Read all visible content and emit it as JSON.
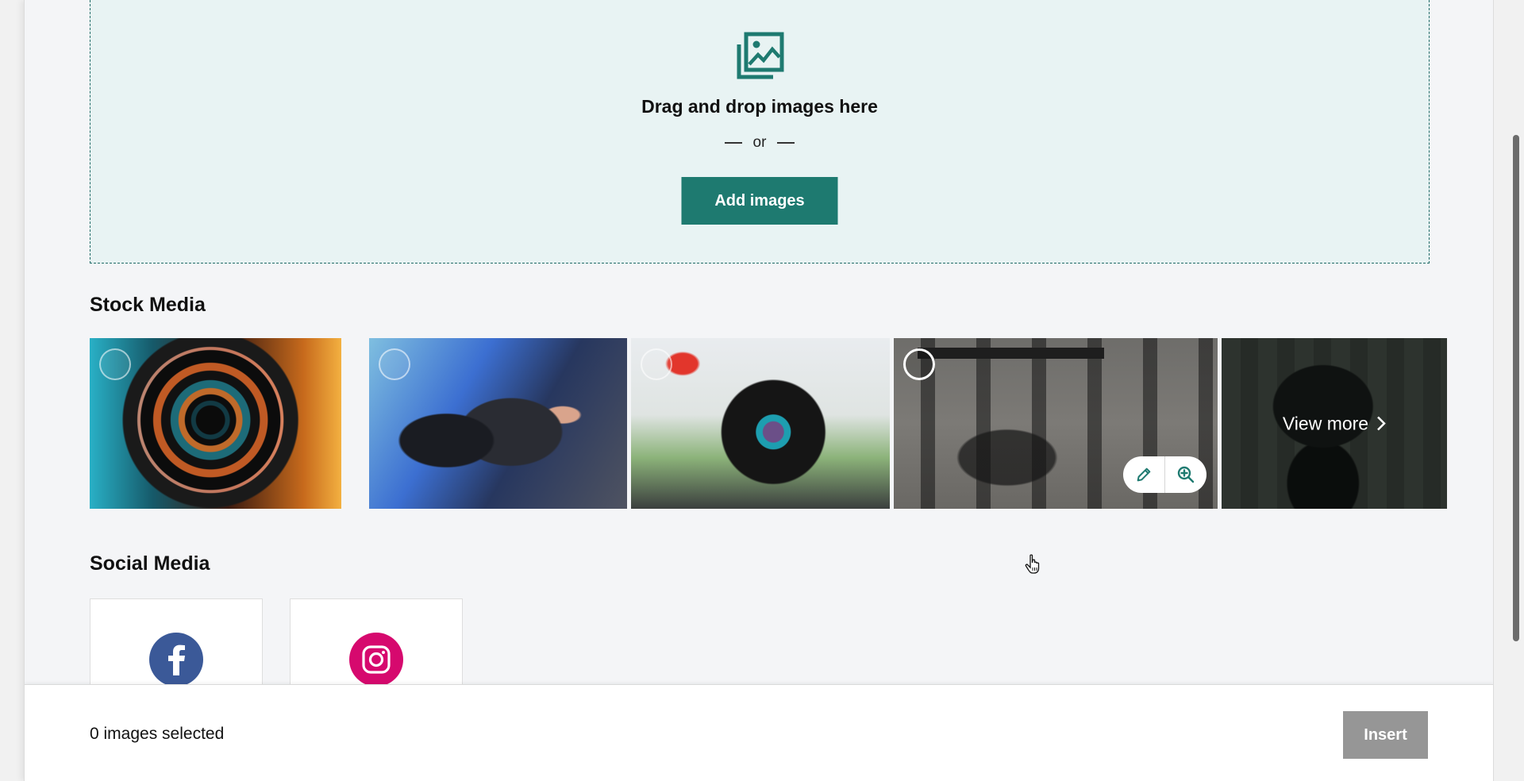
{
  "dropzone": {
    "icon": "image-gallery-icon",
    "title": "Drag and drop images here",
    "or_text": "or",
    "add_button": "Add images"
  },
  "stock_media": {
    "title": "Stock Media",
    "tiles": [
      {
        "name": "camera-lens-closeup",
        "selected": false
      },
      {
        "name": "broadcast-video-camera",
        "selected": false
      },
      {
        "name": "cinema-camera-rig",
        "selected": false
      },
      {
        "name": "camera-gear-flatlay",
        "selected": false,
        "hovered": true,
        "actions": [
          "edit",
          "zoom"
        ]
      }
    ],
    "view_more": "View more"
  },
  "social_media": {
    "title": "Social Media",
    "items": [
      {
        "name": "Facebook",
        "icon": "facebook-icon",
        "color": "#3b5998"
      },
      {
        "name": "Instagram",
        "icon": "instagram-icon",
        "color": "#d6096e"
      }
    ]
  },
  "footer": {
    "selected_count": "0 images selected",
    "insert_button": "Insert"
  },
  "colors": {
    "accent": "#1e7a70",
    "dropzone_bg": "#e8f3f3",
    "disabled_button": "#969696"
  }
}
